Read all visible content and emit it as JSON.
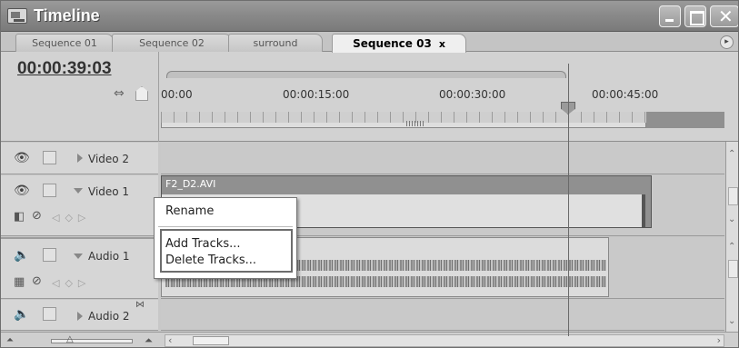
{
  "window": {
    "title": "Timeline"
  },
  "tabs": [
    {
      "label": "Sequence 01"
    },
    {
      "label": "Sequence 02"
    },
    {
      "label": "surround"
    },
    {
      "label": "Sequence 03",
      "close": "x"
    }
  ],
  "timecode": "00:00:39:03",
  "ruler": {
    "labels": [
      "00:00",
      "00:00:15:00",
      "00:00:30:00",
      "00:00:45:00"
    ]
  },
  "tracks": {
    "video2": {
      "name": "Video 2"
    },
    "video1": {
      "name": "Video 1",
      "clip": "F2_D2.AVI"
    },
    "audio1": {
      "name": "Audio 1"
    },
    "audio2": {
      "name": "Audio 2"
    }
  },
  "context_menu": {
    "items": [
      "Rename",
      "Add Tracks...",
      "Delete Tracks..."
    ]
  },
  "icons": {
    "eye": "👁",
    "speaker": "🔈",
    "snap": "⇔",
    "zoom_small": "⏶",
    "zoom_large": "⏶"
  }
}
